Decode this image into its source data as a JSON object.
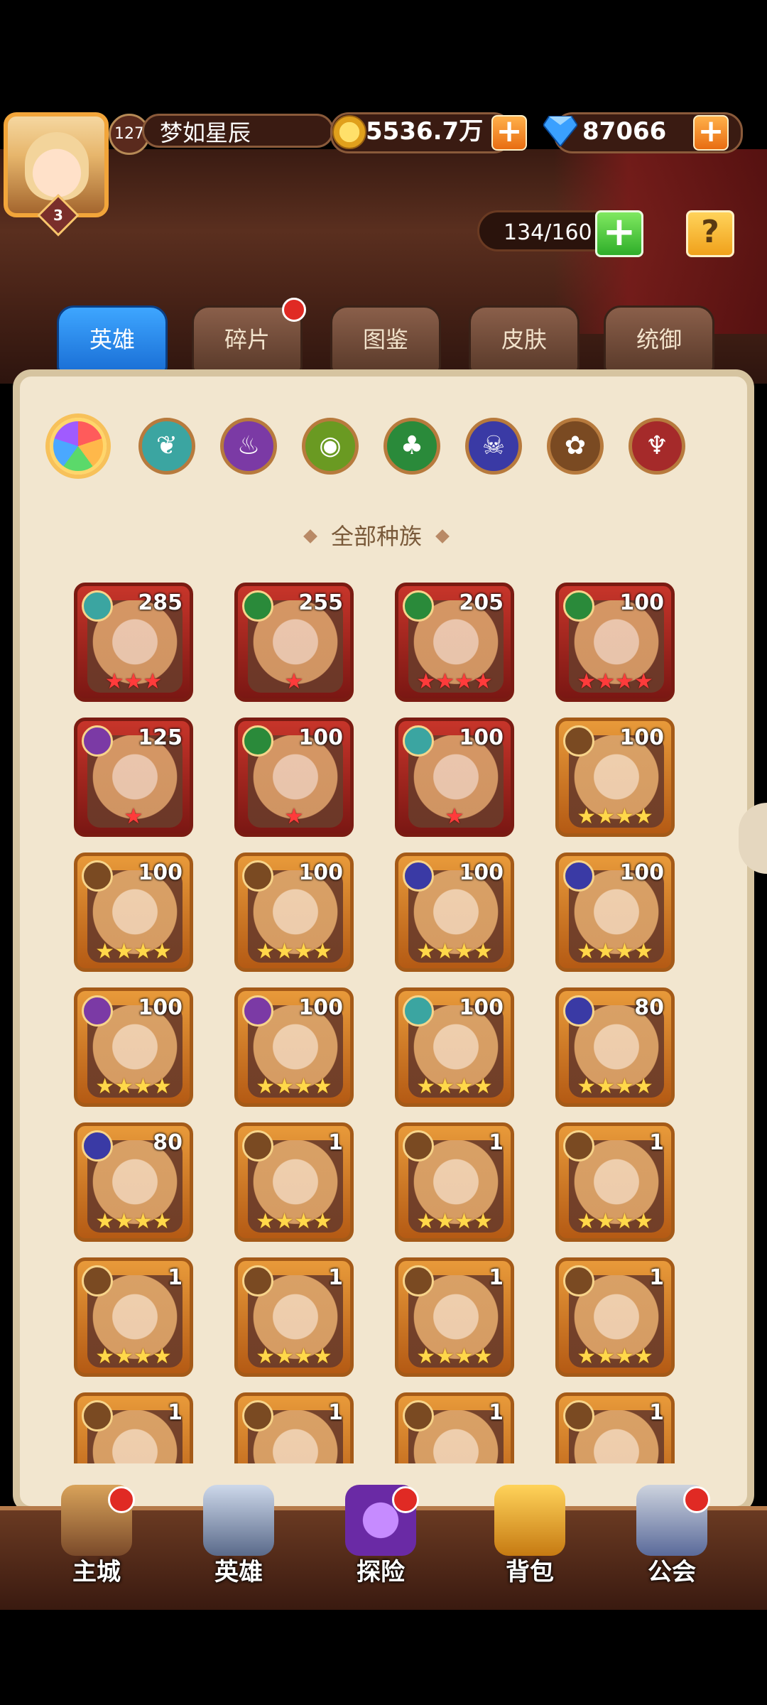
{
  "player": {
    "level_badge": "3",
    "account_level": "127",
    "name": "梦如星辰",
    "gold": "5536.7万",
    "gems": "87066"
  },
  "inventory": {
    "count": "134/160"
  },
  "tabs": [
    {
      "label": "英雄",
      "active": true,
      "badge": false
    },
    {
      "label": "碎片",
      "active": false,
      "badge": true
    },
    {
      "label": "图鉴",
      "active": false,
      "badge": false
    },
    {
      "label": "皮肤",
      "active": false,
      "badge": false
    },
    {
      "label": "统御",
      "active": false,
      "badge": false
    }
  ],
  "race_filters": [
    {
      "icon": "all-races-icon",
      "active": true
    },
    {
      "icon": "forest-icon",
      "active": false
    },
    {
      "icon": "shadow-icon",
      "active": false
    },
    {
      "icon": "fortress-icon",
      "active": false
    },
    {
      "icon": "nature-icon",
      "active": false
    },
    {
      "icon": "abyss-icon",
      "active": false
    },
    {
      "icon": "light-icon",
      "active": false
    },
    {
      "icon": "dark-icon",
      "active": false
    }
  ],
  "race_title": "全部种族",
  "heroes": [
    {
      "level": "285",
      "stars": "★★★",
      "frame": "red"
    },
    {
      "level": "255",
      "stars": "★",
      "frame": "red"
    },
    {
      "level": "205",
      "stars": "★★★★",
      "frame": "red"
    },
    {
      "level": "100",
      "stars": "★★★★",
      "frame": "red"
    },
    {
      "level": "125",
      "stars": "★",
      "frame": "red"
    },
    {
      "level": "100",
      "stars": "★",
      "frame": "red"
    },
    {
      "level": "100",
      "stars": "★",
      "frame": "red"
    },
    {
      "level": "100",
      "stars": "★★★★",
      "frame": "orange"
    },
    {
      "level": "100",
      "stars": "★★★★",
      "frame": "orange"
    },
    {
      "level": "100",
      "stars": "★★★★",
      "frame": "orange"
    },
    {
      "level": "100",
      "stars": "★★★★",
      "frame": "orange"
    },
    {
      "level": "100",
      "stars": "★★★★",
      "frame": "orange"
    },
    {
      "level": "100",
      "stars": "★★★★",
      "frame": "orange"
    },
    {
      "level": "100",
      "stars": "★★★★",
      "frame": "orange"
    },
    {
      "level": "100",
      "stars": "★★★★",
      "frame": "orange"
    },
    {
      "level": "80",
      "stars": "★★★★",
      "frame": "orange"
    },
    {
      "level": "80",
      "stars": "★★★★",
      "frame": "orange"
    },
    {
      "level": "1",
      "stars": "★★★★",
      "frame": "orange"
    },
    {
      "level": "1",
      "stars": "★★★★",
      "frame": "orange"
    },
    {
      "level": "1",
      "stars": "★★★★",
      "frame": "orange"
    },
    {
      "level": "1",
      "stars": "★★★★",
      "frame": "orange"
    },
    {
      "level": "1",
      "stars": "★★★★",
      "frame": "orange"
    },
    {
      "level": "1",
      "stars": "★★★★",
      "frame": "orange"
    },
    {
      "level": "1",
      "stars": "★★★★",
      "frame": "orange"
    },
    {
      "level": "1",
      "stars": "",
      "frame": "orange"
    },
    {
      "level": "1",
      "stars": "",
      "frame": "orange"
    },
    {
      "level": "1",
      "stars": "",
      "frame": "orange"
    },
    {
      "level": "1",
      "stars": "",
      "frame": "orange"
    }
  ],
  "nav": [
    {
      "label": "主城",
      "icon": "castle-icon",
      "badge": true
    },
    {
      "label": "英雄",
      "icon": "hero-icon",
      "badge": false
    },
    {
      "label": "探险",
      "icon": "portal-icon",
      "badge": true
    },
    {
      "label": "背包",
      "icon": "backpack-icon",
      "badge": false
    },
    {
      "label": "公会",
      "icon": "guild-icon",
      "badge": true
    }
  ],
  "colors": {
    "tab_active": "#1a6fd6",
    "badge_red": "#e02a24",
    "panel_bg": "#f2e6cf"
  }
}
